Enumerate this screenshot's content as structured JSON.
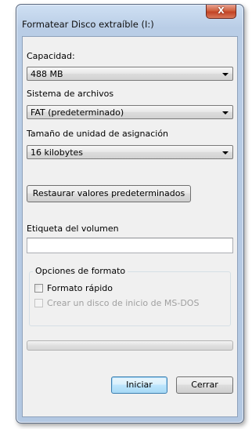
{
  "window": {
    "title": "Formatear Disco extraíble (I:)",
    "close_glyph": "X"
  },
  "capacity": {
    "label": "Capacidad:",
    "value": "488 MB"
  },
  "filesystem": {
    "label": "Sistema de archivos",
    "value": "FAT (predeterminado)"
  },
  "allocation": {
    "label": "Tamaño de unidad de asignación",
    "value": "16 kilobytes"
  },
  "restore_button": "Restaurar valores predeterminados",
  "volume_label": {
    "label": "Etiqueta del volumen",
    "value": ""
  },
  "format_options": {
    "title": "Opciones de formato",
    "quick_format": {
      "label": "Formato rápido",
      "checked": false,
      "enabled": true
    },
    "msdos_boot": {
      "label": "Crear un disco de inicio de MS-DOS",
      "checked": false,
      "enabled": false
    }
  },
  "progress": {
    "value": 0
  },
  "buttons": {
    "start": "Iniciar",
    "close": "Cerrar"
  }
}
